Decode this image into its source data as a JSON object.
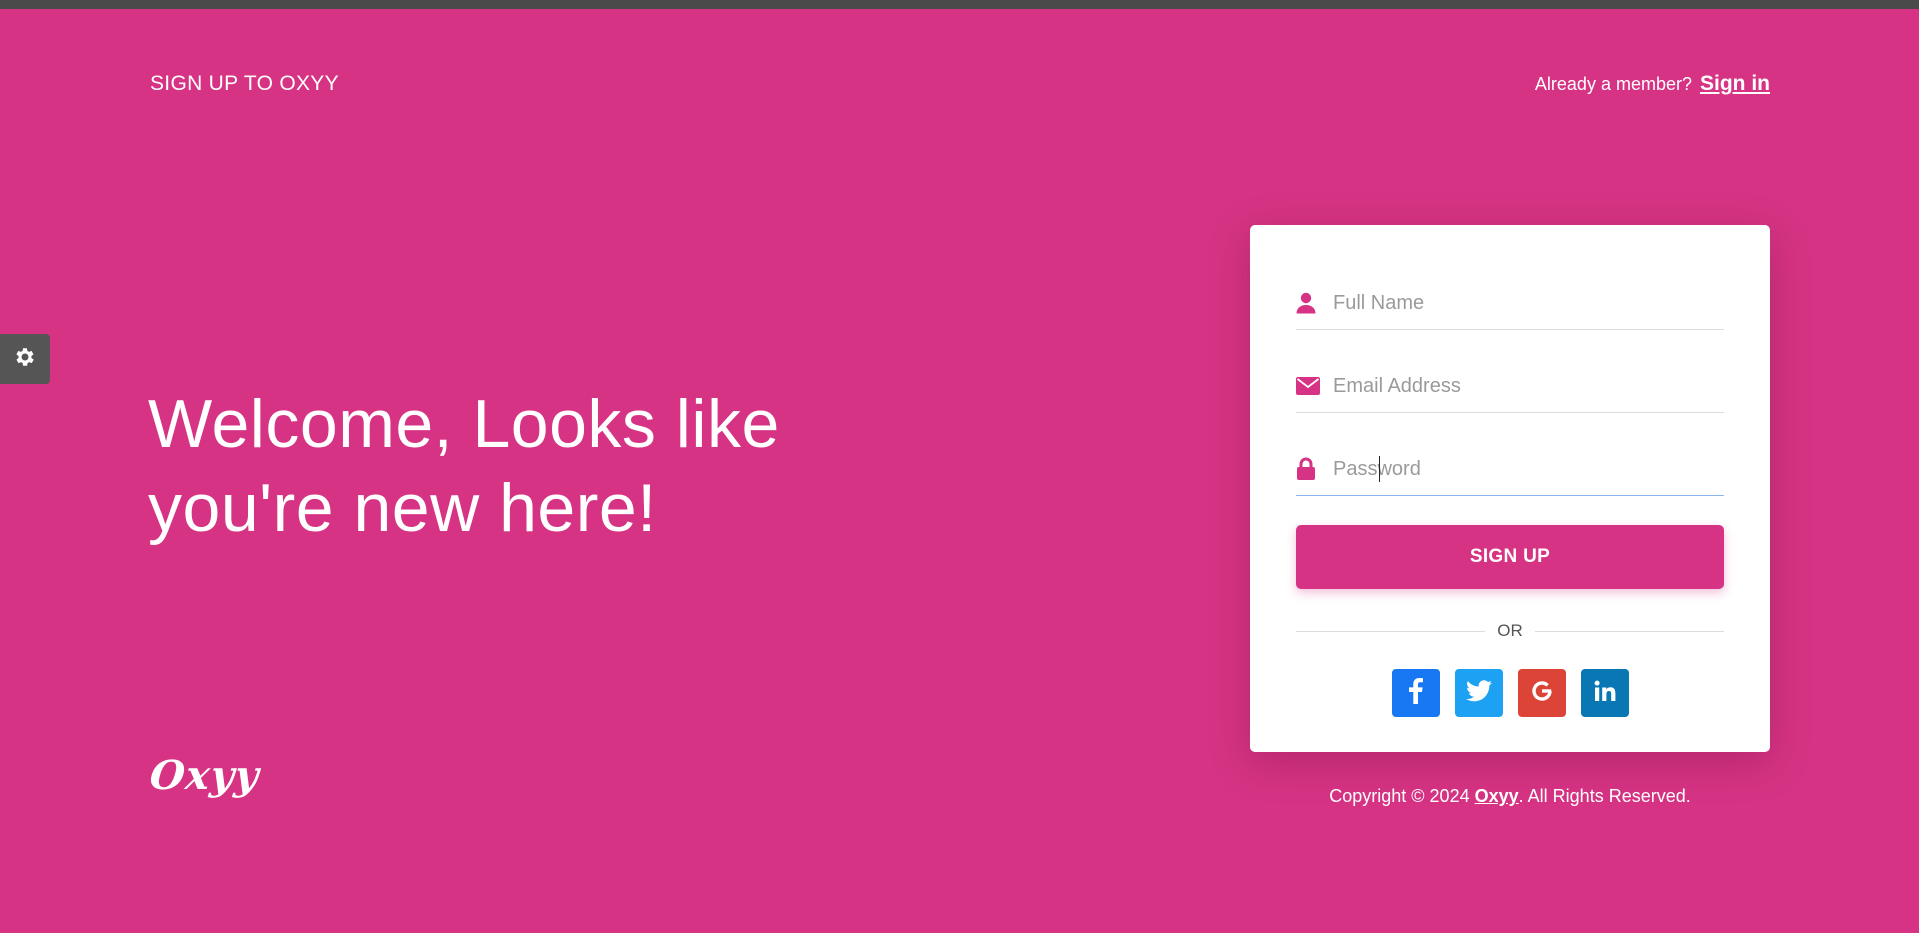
{
  "header": {
    "brand_title": "SIGN UP TO OXYY",
    "member_text": "Already a member?",
    "signin_link": "Sign in"
  },
  "hero": {
    "line1": "Welcome, Looks like",
    "line2": "you're new here!"
  },
  "logo_text": "Oxyy",
  "form": {
    "fullname_placeholder": "Full Name",
    "email_placeholder": "Email Address",
    "password_placeholder": "Password",
    "signup_label": "SIGN UP",
    "or_label": "OR"
  },
  "social": [
    "facebook-icon",
    "twitter-icon",
    "google-icon",
    "linkedin-icon"
  ],
  "footer": {
    "copyright_prefix": "Copyright © 2024 ",
    "brand_link": "Oxyy",
    "copyright_suffix": ". All Rights Reserved."
  },
  "colors": {
    "background": "#d63384",
    "accent": "#d63384",
    "facebook": "#1877f2",
    "twitter": "#1da1f2",
    "google": "#db4437",
    "linkedin": "#0a77b5"
  }
}
